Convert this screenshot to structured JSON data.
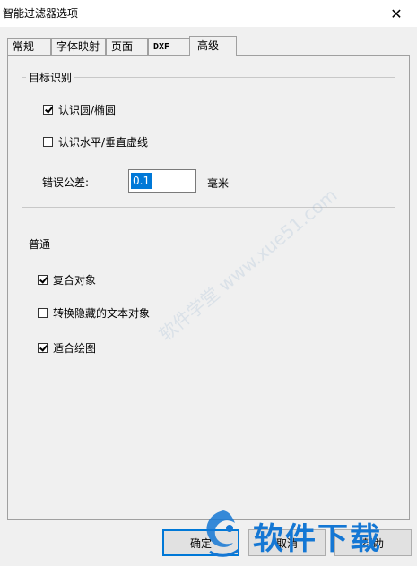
{
  "window": {
    "title": "智能过滤器选项"
  },
  "tabs": [
    {
      "label": "常规"
    },
    {
      "label": "字体映射"
    },
    {
      "label": "页面"
    },
    {
      "label": "DXF"
    },
    {
      "label": "高级",
      "active": true
    }
  ],
  "target_group": {
    "legend": "目标识别",
    "options": [
      {
        "label": "认识圆/椭圆",
        "checked": true
      },
      {
        "label": "认识水平/垂直虚线",
        "checked": false
      }
    ],
    "tolerance": {
      "label": "错误公差:",
      "value": "0.1",
      "unit": "毫米"
    }
  },
  "general_group": {
    "legend": "普通",
    "options": [
      {
        "label": "复合对象",
        "checked": true
      },
      {
        "label": "转换隐藏的文本对象",
        "checked": false
      },
      {
        "label": "适合绘图",
        "checked": true
      }
    ]
  },
  "buttons": {
    "ok": "确定",
    "cancel": "取消",
    "help": "帮助"
  },
  "watermark": {
    "diagonal": "软件学堂 www.xue51.com",
    "logo_text": "软件下载"
  },
  "colors": {
    "selection": "#0078d7",
    "logo": "#1477d4"
  }
}
